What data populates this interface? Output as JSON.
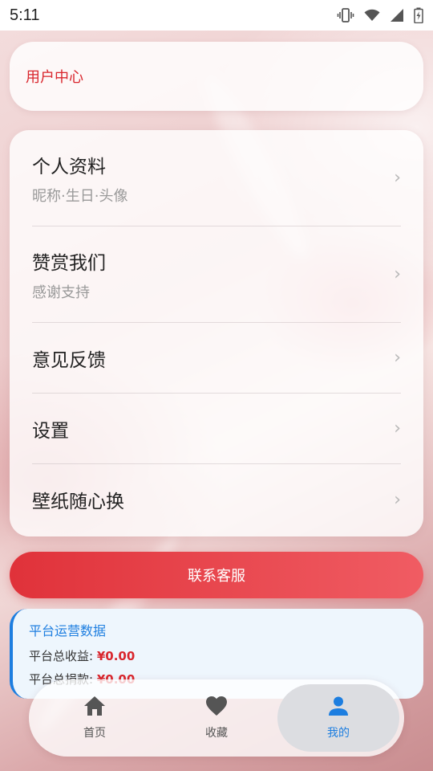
{
  "status_bar": {
    "time": "5:11",
    "icons": [
      "vibrate-icon",
      "wifi-icon",
      "signal-icon",
      "battery-icon"
    ]
  },
  "header": {
    "title": "用户中心"
  },
  "menu": {
    "items": [
      {
        "title": "个人资料",
        "subtitle": "昵称·生日·头像"
      },
      {
        "title": "赞赏我们",
        "subtitle": "感谢支持"
      },
      {
        "title": "意见反馈"
      },
      {
        "title": "设置"
      },
      {
        "title": "壁纸随心换"
      }
    ],
    "chevron": "›"
  },
  "contact_button": {
    "label": "联系客服"
  },
  "stats": {
    "title": "平台运营数据",
    "rows": [
      {
        "label": "平台总收益:",
        "value": "¥0.00"
      },
      {
        "label": "平台总捐款:",
        "value": "¥0.00"
      }
    ]
  },
  "bottom_nav": {
    "items": [
      {
        "label": "首页",
        "icon": "home-icon"
      },
      {
        "label": "收藏",
        "icon": "heart-icon"
      },
      {
        "label": "我的",
        "icon": "person-icon",
        "active": true
      }
    ]
  },
  "colors": {
    "accent_red": "#d9262d",
    "accent_blue": "#1d7ee0",
    "nav_icon_gray": "#555555"
  }
}
